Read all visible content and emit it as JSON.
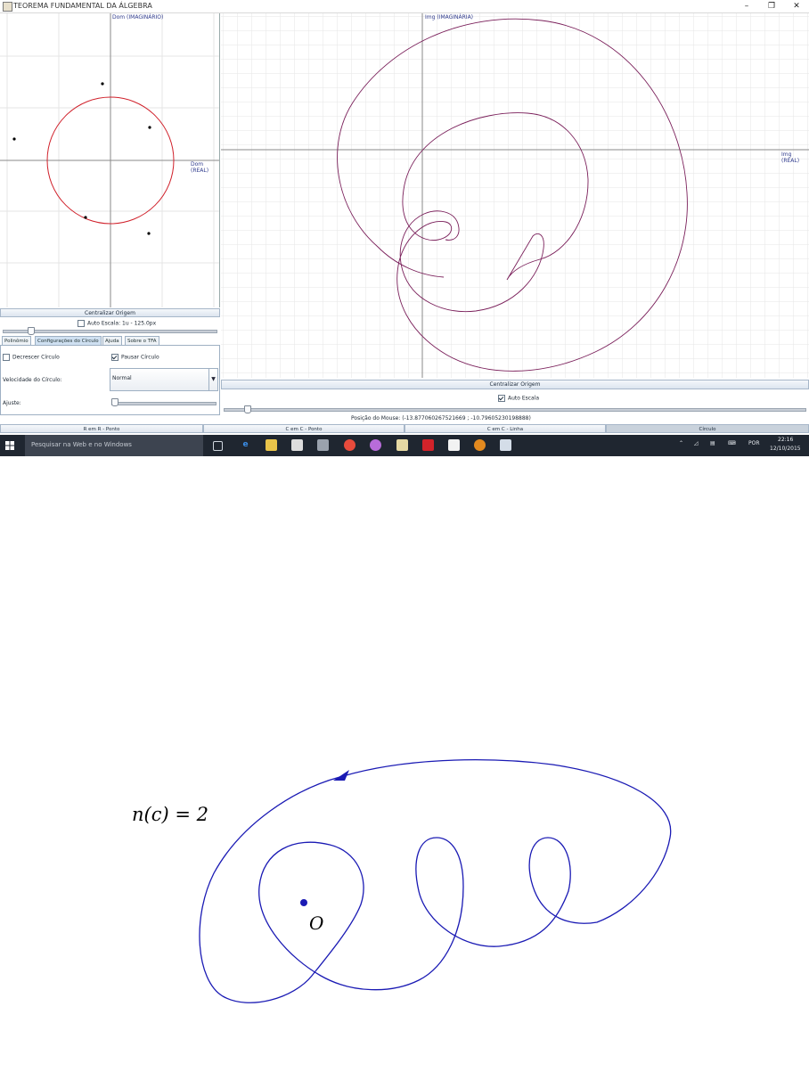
{
  "window": {
    "title": "TEOREMA FUNDAMENTAL DA ÁLGEBRA",
    "minimize": "–",
    "restore": "❐",
    "close": "✕"
  },
  "left_plot": {
    "y_axis_label": "Dom (IMAGINÁRIO)",
    "x_axis_label": "Dom (REAL)"
  },
  "right_plot": {
    "y_axis_label": "Img (IMAGINÁRIA)",
    "x_axis_label": "Img (REAL)"
  },
  "left_controls": {
    "center_button": "Centralizar Origem",
    "auto_scale_label": "Auto Escala: 1u - 125.0px",
    "auto_scale_checked": false,
    "zoom_fraction": 0.14
  },
  "tabs": [
    {
      "label": "Polinômio",
      "active": false
    },
    {
      "label": "Configurações do Círculo",
      "active": true
    },
    {
      "label": "Ajuda",
      "active": false
    },
    {
      "label": "Sobre o TFA",
      "active": false
    }
  ],
  "circle_settings": {
    "decrease_label": "Decrescer Círculo",
    "decrease_checked": false,
    "pause_label": "Pausar Círculo",
    "pause_checked": true,
    "speed_label": "Velocidade do Círculo:",
    "speed_value": "Normal",
    "adjust_label": "Ajuste:",
    "adjust_fraction": 0.02
  },
  "right_controls": {
    "center_button": "Centralizar Origem",
    "auto_scale_label": "Auto Escala",
    "auto_scale_checked": true,
    "zoom_fraction": 0.04,
    "mouse_position": "Posição do Mouse: (-13.877060267521669 ; -10.79605230198888)"
  },
  "mode_tabs": [
    {
      "label": "R em R - Ponto",
      "selected": false
    },
    {
      "label": "C em C - Ponto",
      "selected": false
    },
    {
      "label": "C em C - Linha",
      "selected": false
    },
    {
      "label": "Círculo",
      "selected": true
    }
  ],
  "taskbar": {
    "search_placeholder": "Pesquisar na Web e no Windows",
    "language": "POR",
    "time": "22:16",
    "date": "12/10/2015"
  },
  "figure": {
    "winding_label": "n(c) = 2",
    "origin_label": "O"
  },
  "colors": {
    "circle": "#d0202a",
    "image_curve": "#7a1f5a",
    "axis_label": "#2e3a8c",
    "figure_curve": "#1a1ab4"
  }
}
